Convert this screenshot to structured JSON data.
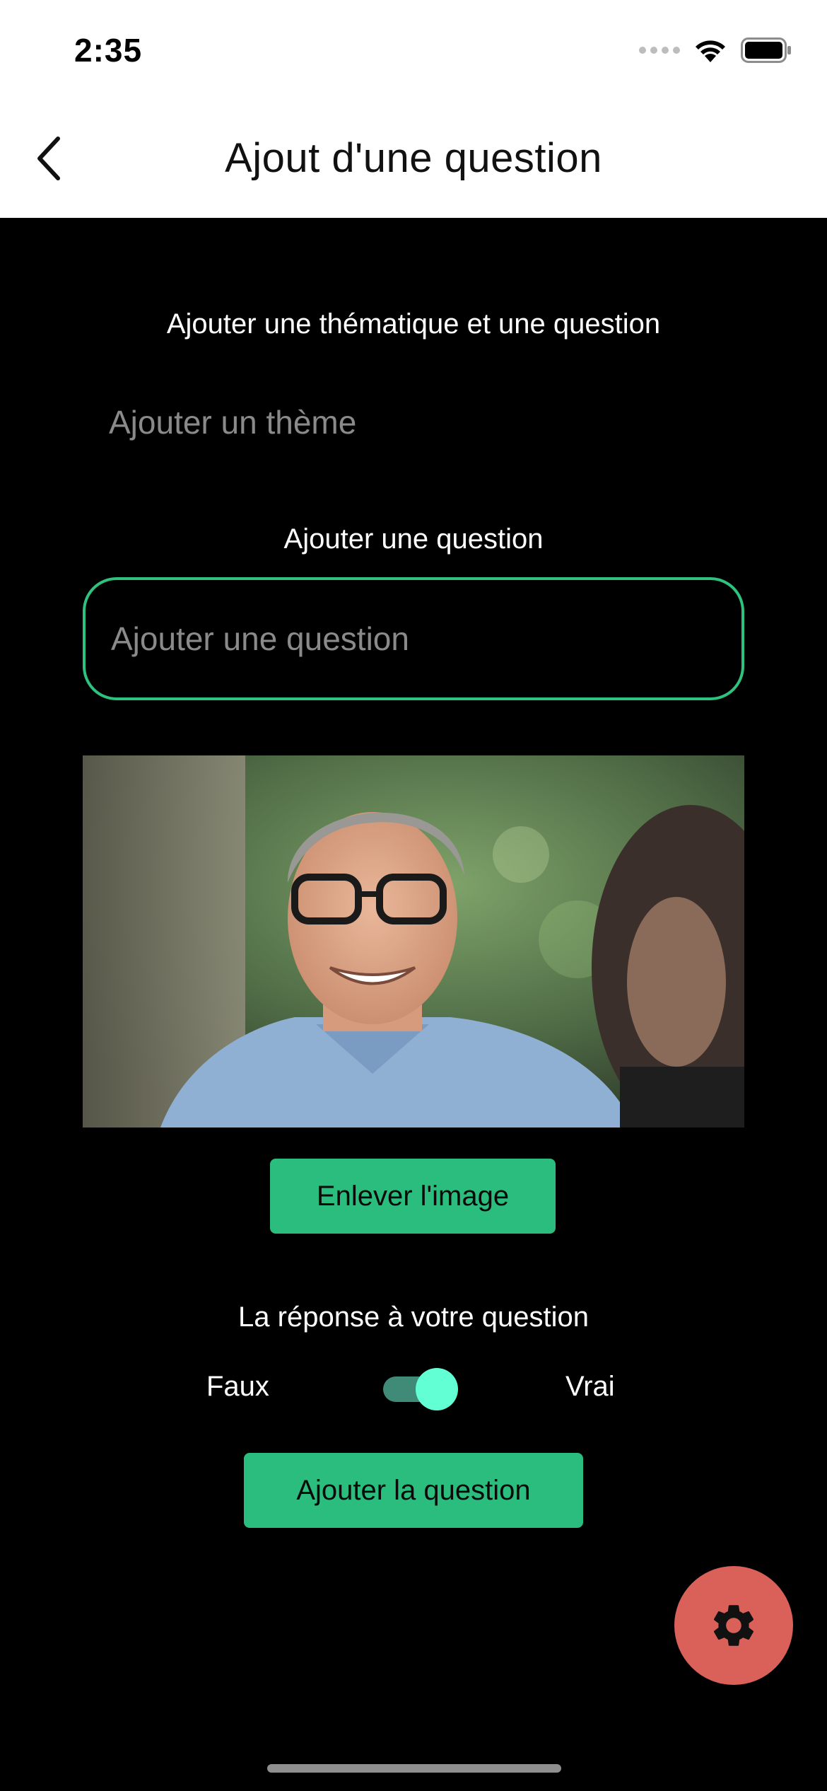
{
  "status_bar": {
    "time": "2:35"
  },
  "app_bar": {
    "title": "Ajout d'une question"
  },
  "form": {
    "intro_label": "Ajouter une thématique et une question",
    "theme_placeholder": "Ajouter un thème",
    "question_label": "Ajouter une question",
    "question_placeholder": "Ajouter une question",
    "remove_image_label": "Enlever l'image",
    "answer_label": "La réponse à votre question",
    "false_label": "Faux",
    "true_label": "Vrai",
    "answer_value": true,
    "submit_label": "Ajouter la question"
  },
  "icons": {
    "back": "chevron-left-icon",
    "settings": "gear-icon",
    "wifi": "wifi-icon",
    "battery": "battery-icon",
    "signal": "signal-icon"
  },
  "colors": {
    "accent": "#2bbd7e",
    "question_border": "#2ec27e",
    "switch_thumb": "#63ffd4",
    "switch_track": "#3f8b78",
    "fab": "#d9615a",
    "background": "#000000"
  }
}
